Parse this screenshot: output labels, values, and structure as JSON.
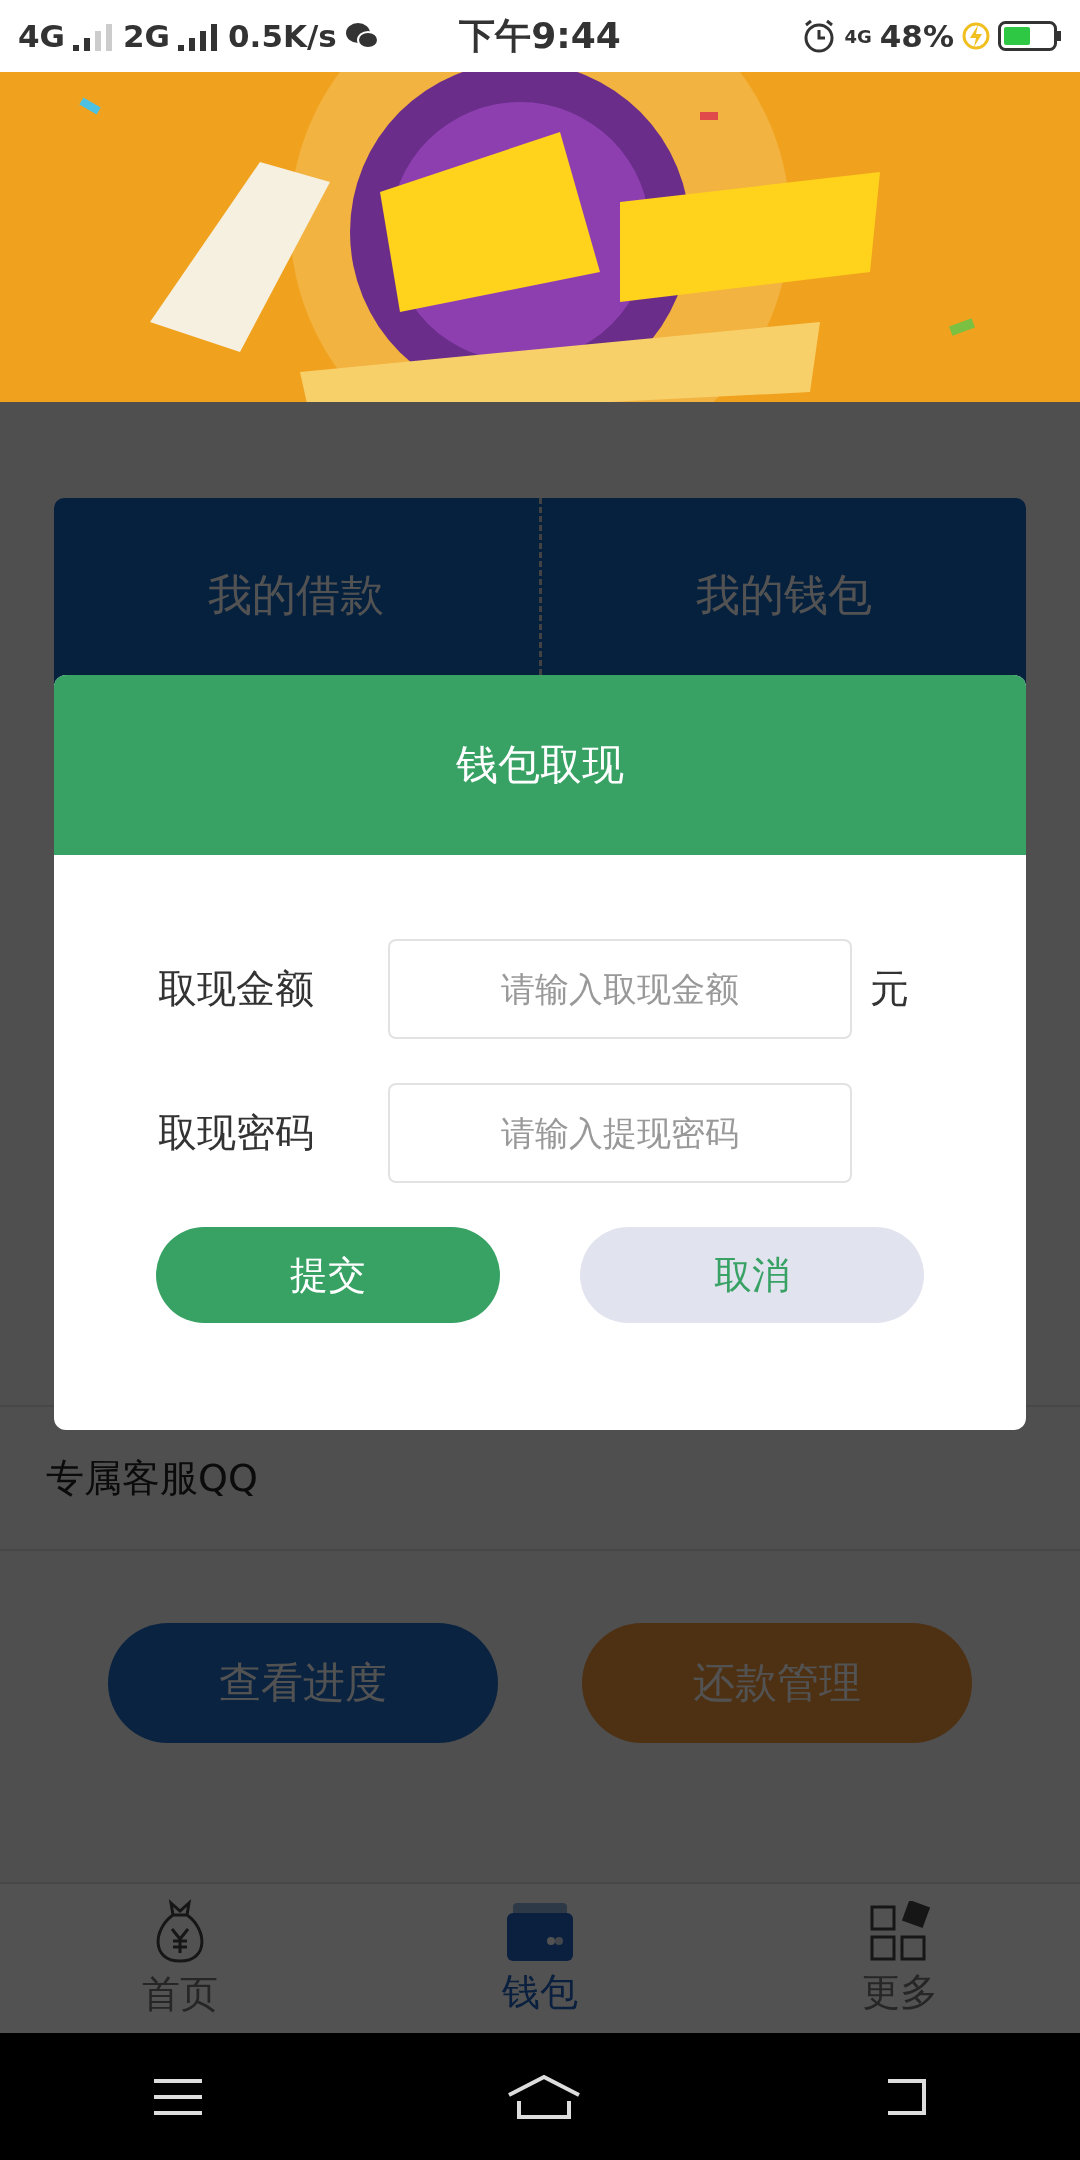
{
  "status_bar": {
    "network_1": "4G",
    "network_2": "2G",
    "speed": "0.5K/s",
    "time": "下午9:44",
    "network_3": "4G",
    "battery": "48%"
  },
  "summary_card": {
    "items": [
      {
        "label": "我的借款"
      },
      {
        "label": "我的钱包"
      }
    ]
  },
  "list_rows": [
    {
      "label": "专属客服QQ"
    }
  ],
  "action_buttons": [
    {
      "label": "查看进度",
      "kind": "progress"
    },
    {
      "label": "还款管理",
      "kind": "repayment"
    }
  ],
  "tab_bar": [
    {
      "label": "首页",
      "kind": "home",
      "selected": false
    },
    {
      "label": "钱包",
      "kind": "wallet",
      "selected": true
    },
    {
      "label": "更多",
      "kind": "more",
      "selected": false
    }
  ],
  "dialog": {
    "title": "钱包取现",
    "fields": [
      {
        "label": "取现金额",
        "placeholder": "请输入取现金额",
        "unit": "元"
      },
      {
        "label": "取现密码",
        "placeholder": "请输入提现密码"
      }
    ],
    "buttons": [
      {
        "label": "提交",
        "kind": "primary"
      },
      {
        "label": "取消",
        "kind": "secondary"
      }
    ]
  }
}
